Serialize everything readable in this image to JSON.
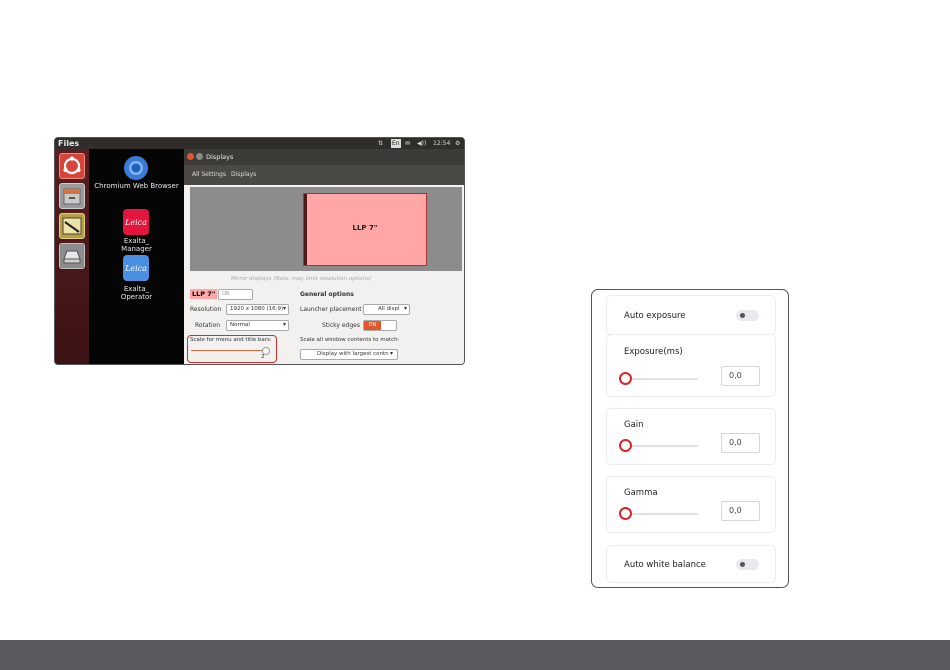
{
  "ubuntu": {
    "topbar_title": "Files",
    "indicators": [
      "⇅",
      "En",
      "✉",
      "◀))",
      "12:54",
      "⚙"
    ],
    "desktop_icons": [
      {
        "label": "Chromium Web Browser",
        "icon": "chromium-icon",
        "color": "#3a7bd5"
      },
      {
        "label": "Exalta_ Manager",
        "icon": "leica-logo-icon",
        "color": "#e3173e"
      },
      {
        "label": "Exalta_ Operator",
        "icon": "leica-logo-icon",
        "color": "#4a8fe0"
      }
    ],
    "window_title": "Displays",
    "nav": {
      "all_settings": "All Settings",
      "displays": "Displays"
    },
    "monitor_label": "LLP 7\"",
    "mirror_text": "Mirror displays (Note: may limit resolution options)",
    "display_name": "LLP 7\"",
    "display_toggle": "ON",
    "resolution_label": "Resolution",
    "resolution_value": "1920 x 1080 (16:9)",
    "rotation_label": "Rotation",
    "rotation_value": "Normal",
    "scale_label": "Scale for menu and title bars:",
    "scale_value": "2",
    "general_title": "General options",
    "launcher_label": "Launcher placement",
    "launcher_value": "All displ",
    "sticky_label": "Sticky edges",
    "sticky_value": "ON",
    "scale_all_label": "Scale all window contents to match:",
    "scale_all_value": "Display with largest contn"
  },
  "panel": {
    "auto_exposure": "Auto exposure",
    "exposure_label": "Exposure(ms)",
    "exposure_value": "0,0",
    "gain_label": "Gain",
    "gain_value": "0,0",
    "gamma_label": "Gamma",
    "gamma_value": "0,0",
    "auto_white_balance": "Auto white balance",
    "accent": "#d8262c"
  }
}
